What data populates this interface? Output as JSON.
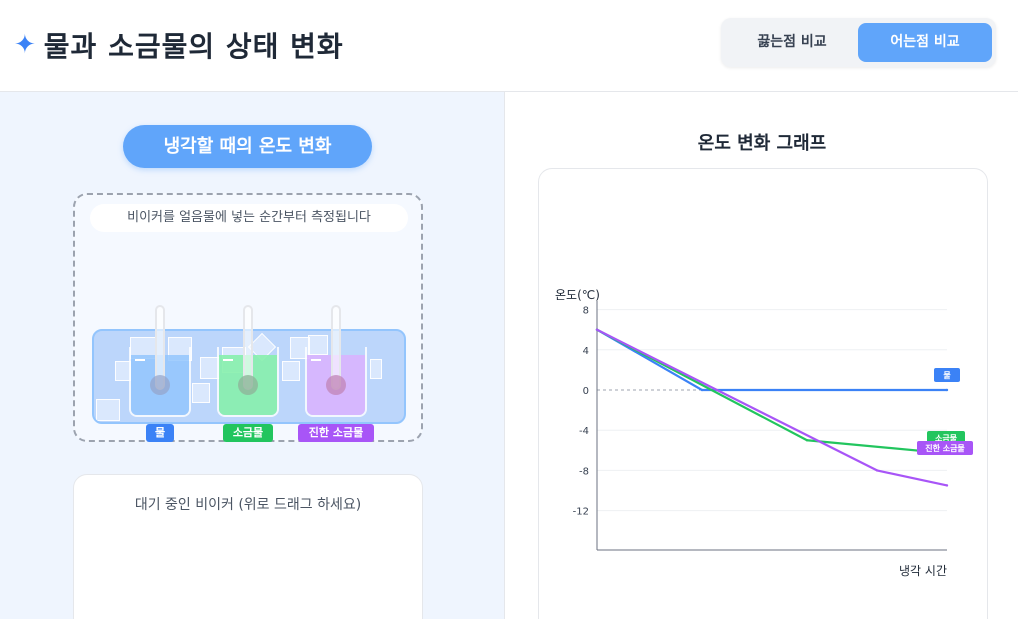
{
  "header": {
    "title": "물과 소금물의 상태 변화",
    "tabs": [
      {
        "label": "끓는점 비교",
        "active": false
      },
      {
        "label": "어는점 비교",
        "active": true
      }
    ]
  },
  "left": {
    "section_title": "냉각할 때의 온도 변화",
    "hint": "비이커를 얼음물에 넣는 순간부터 측정됩니다",
    "beakers": [
      {
        "label": "물",
        "color": "#3b82f6"
      },
      {
        "label": "소금물",
        "color": "#22c55e"
      },
      {
        "label": "진한 소금물",
        "color": "#a855f7"
      }
    ],
    "waiting_label": "대기 중인 비이커 (위로 드래그 하세요)"
  },
  "right": {
    "graph_title": "온도 변화 그래프"
  },
  "chart_data": {
    "type": "line",
    "ylabel": "온도(℃)",
    "xlabel": "냉각 시간",
    "yticks": [
      "8",
      "4",
      "0",
      "-4",
      "-8",
      "-12"
    ],
    "ylim": [
      -16,
      8
    ],
    "xlim": [
      0,
      10
    ],
    "zero_line": "dashed",
    "series": [
      {
        "name": "물",
        "color": "#3b82f6",
        "points": [
          [
            0,
            6
          ],
          [
            3,
            0
          ],
          [
            10,
            0
          ]
        ]
      },
      {
        "name": "소금물",
        "color": "#22c55e",
        "points": [
          [
            0,
            6
          ],
          [
            6,
            -5
          ],
          [
            10,
            -6.3
          ]
        ]
      },
      {
        "name": "진한 소금물",
        "color": "#a855f7",
        "points": [
          [
            0,
            6
          ],
          [
            8,
            -8
          ],
          [
            10,
            -9.5
          ]
        ]
      }
    ]
  }
}
